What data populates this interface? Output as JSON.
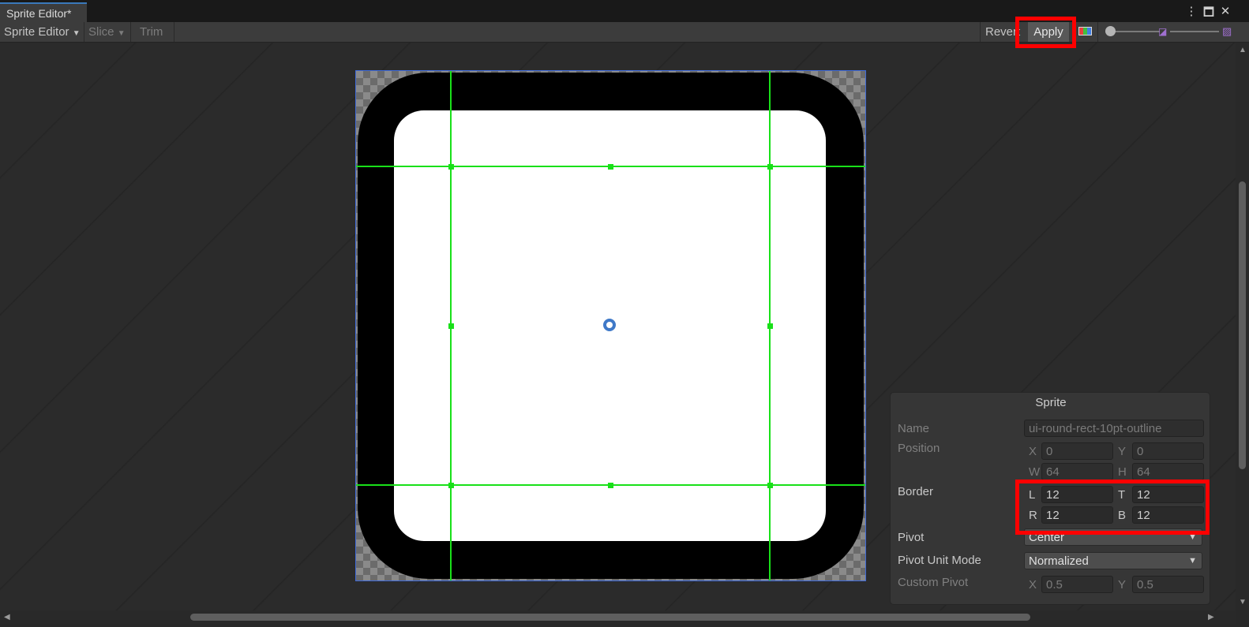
{
  "window": {
    "tab_title": "Sprite Editor*",
    "menu_icon": "kebab-menu-icon",
    "maximize_icon": "maximize-icon",
    "close_icon": "close-icon"
  },
  "toolbar": {
    "mode_label": "Sprite Editor",
    "slice_label": "Slice",
    "trim_label": "Trim",
    "revert_label": "Revert",
    "apply_label": "Apply",
    "channel_icon": "color-channel-icon",
    "mip_low_icon": "mip-low-icon",
    "mip_high_icon": "mip-high-icon",
    "zoom_level": 0
  },
  "sprite_panel": {
    "title": "Sprite",
    "name_label": "Name",
    "name_value": "ui-round-rect-10pt-outline",
    "position_label": "Position",
    "x_label": "X",
    "x_value": "0",
    "y_label": "Y",
    "y_value": "0",
    "w_label": "W",
    "w_value": "64",
    "h_label": "H",
    "h_value": "64",
    "border_label": "Border",
    "l_label": "L",
    "l_value": "12",
    "t_label": "T",
    "t_value": "12",
    "r_label": "R",
    "r_value": "12",
    "b_label": "B",
    "b_value": "12",
    "pivot_label": "Pivot",
    "pivot_value": "Center",
    "pivot_unit_label": "Pivot Unit Mode",
    "pivot_unit_value": "Normalized",
    "custom_pivot_label": "Custom Pivot",
    "cp_x_label": "X",
    "cp_x_value": "0.5",
    "cp_y_label": "Y",
    "cp_y_value": "0.5"
  },
  "colors": {
    "highlight": "#ff0000",
    "guide": "#19e019",
    "frame": "#3f6ad8"
  }
}
